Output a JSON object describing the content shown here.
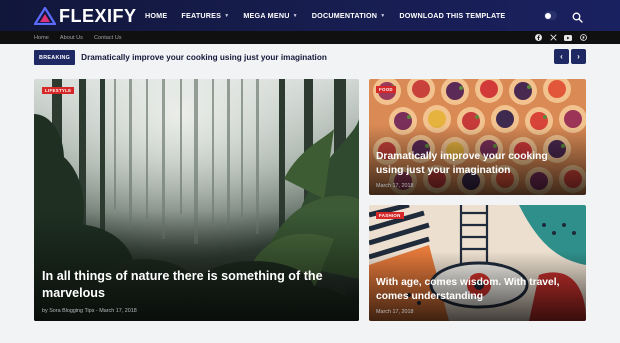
{
  "brand": {
    "name": "Flexify",
    "logo_text": "FLEXIFY",
    "colors": {
      "header": "#141a47",
      "accent": "#d62828",
      "navy": "#1e2862"
    }
  },
  "nav": {
    "items": [
      {
        "label": "HOME",
        "dropdown": false
      },
      {
        "label": "FEATURES",
        "dropdown": true
      },
      {
        "label": "MEGA MENU",
        "dropdown": true
      },
      {
        "label": "DOCUMENTATION",
        "dropdown": true
      },
      {
        "label": "DOWNLOAD THIS TEMPLATE",
        "dropdown": false
      }
    ],
    "caret_glyph": "▼",
    "icons": {
      "theme_toggle": "dark-mode-toggle-icon",
      "search": "search-icon"
    }
  },
  "subbar": {
    "links": [
      "Home",
      "About Us",
      "Contact Us"
    ],
    "socials": [
      "facebook-icon",
      "x-twitter-icon",
      "youtube-icon",
      "pinterest-icon"
    ]
  },
  "ticker": {
    "label": "BREAKING",
    "headline": "Dramatically improve your cooking using just your imagination",
    "prev_glyph": "‹",
    "next_glyph": "›"
  },
  "featured": [
    {
      "tag": "Lifestyle",
      "title": "In all things of nature there is something of the marvelous",
      "meta": "by Sora Blogging Tips - March 17, 2018"
    },
    {
      "tag": "Food",
      "title": "Dramatically improve your cooking using just your imagination",
      "meta": "March 17, 2018"
    },
    {
      "tag": "Fashion",
      "title": "With age, comes wisdom. With travel, comes understanding",
      "meta": "March 17, 2018"
    }
  ]
}
